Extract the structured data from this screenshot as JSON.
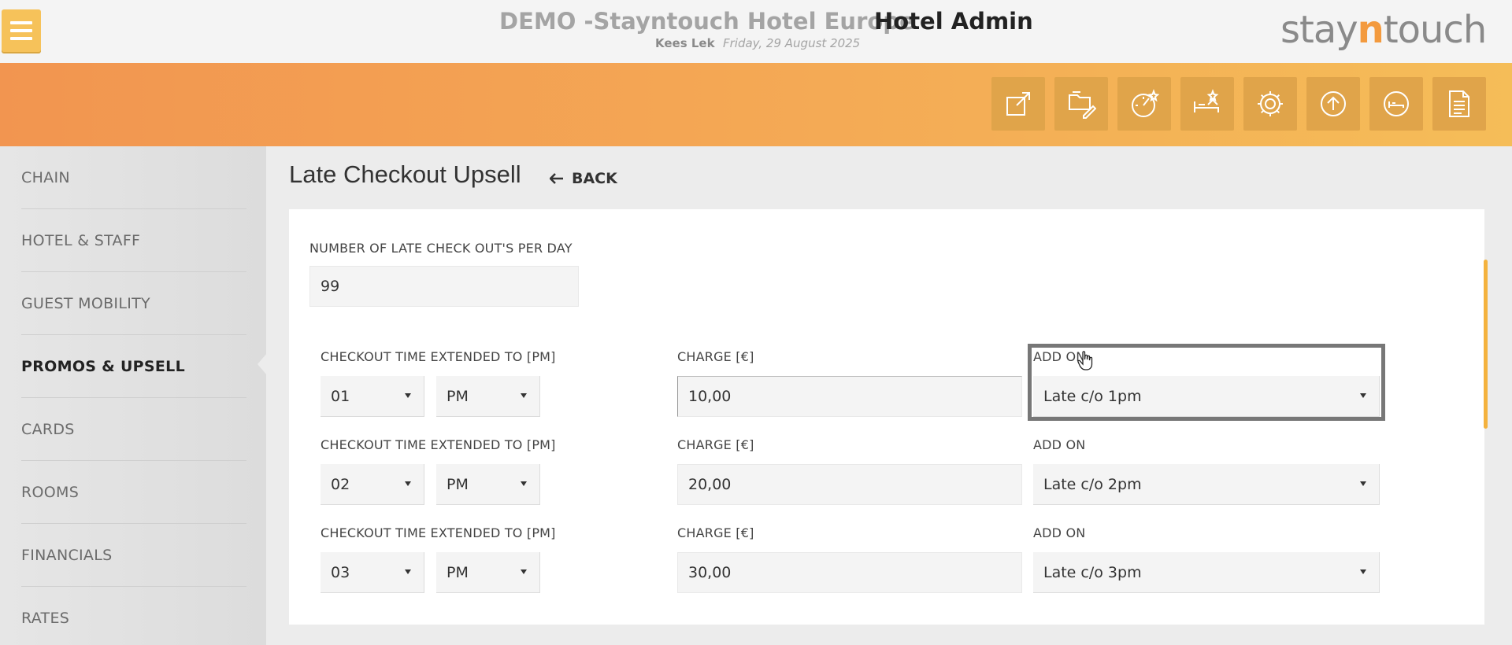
{
  "header": {
    "hotel_title": "DEMO -Stayntouch Hotel Europe",
    "admin_title": "Hotel Admin",
    "user_name": "Kees Lek",
    "date": "Friday, 29 August 2025",
    "logo_pre": "stay",
    "logo_n": "n",
    "logo_post": "touch"
  },
  "toolbar": {
    "icons": [
      "external-link-icon",
      "folder-edit-icon",
      "dashboard-star-icon",
      "bed-star-icon",
      "gear-icon",
      "upload-circle-icon",
      "guest-icon",
      "document-icon"
    ]
  },
  "colors": {
    "accent": "#f5a04f",
    "menu": "#f6c25a",
    "scroll": "#f4b23e"
  },
  "sidebar": {
    "items": [
      {
        "label": "CHAIN"
      },
      {
        "label": "HOTEL & STAFF"
      },
      {
        "label": "GUEST MOBILITY"
      },
      {
        "label": "PROMOS & UPSELL"
      },
      {
        "label": "CARDS"
      },
      {
        "label": "ROOMS"
      },
      {
        "label": "FINANCIALS"
      },
      {
        "label": "RATES"
      }
    ],
    "active": "PROMOS & UPSELL"
  },
  "page": {
    "title": "Late Checkout Upsell",
    "back_label": "BACK"
  },
  "form": {
    "per_day_label": "NUMBER OF LATE CHECK OUT'S PER DAY",
    "per_day_value": "99",
    "rows": [
      {
        "time_label": "CHECKOUT TIME EXTENDED TO [PM]",
        "hour": "01",
        "ampm": "PM",
        "charge_label": "CHARGE [€]",
        "charge": "10,00",
        "addon_label": "ADD ON",
        "addon": "Late c/o 1pm"
      },
      {
        "time_label": "CHECKOUT TIME EXTENDED TO [PM]",
        "hour": "02",
        "ampm": "PM",
        "charge_label": "CHARGE [€]",
        "charge": "20,00",
        "addon_label": "ADD ON",
        "addon": "Late c/o 2pm"
      },
      {
        "time_label": "CHECKOUT TIME EXTENDED TO [PM]",
        "hour": "03",
        "ampm": "PM",
        "charge_label": "CHARGE [€]",
        "charge": "30,00",
        "addon_label": "ADD ON",
        "addon": "Late c/o 3pm"
      }
    ]
  }
}
